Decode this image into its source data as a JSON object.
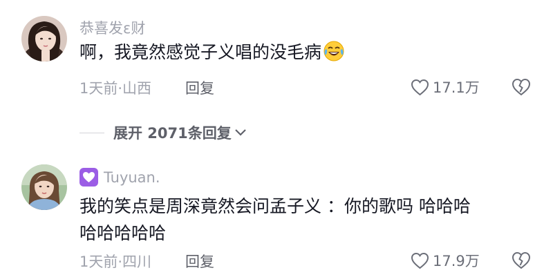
{
  "comments": [
    {
      "username": "恭喜发ε财",
      "text": "啊，我竟然感觉子义唱的没毛病",
      "emoji": "laughing-crying-emoji",
      "time_location": "1天前·山西",
      "reply_label": "回复",
      "like_count": "17.1万"
    },
    {
      "username": "Tuyuan.",
      "badge": "heart-badge-icon",
      "text_line1": "我的笑点是周深竟然会问孟子义 ：你的歌吗 哈哈哈",
      "text_line2": "哈哈哈哈哈",
      "time_location": "1天前·四川",
      "reply_label": "回复",
      "like_count": "17.9万"
    }
  ],
  "expand_replies": {
    "label": "展开 2071条回复"
  },
  "colors": {
    "meta_text": "#a0a3ad",
    "primary_text": "#161823",
    "badge": "#9b5de5"
  }
}
